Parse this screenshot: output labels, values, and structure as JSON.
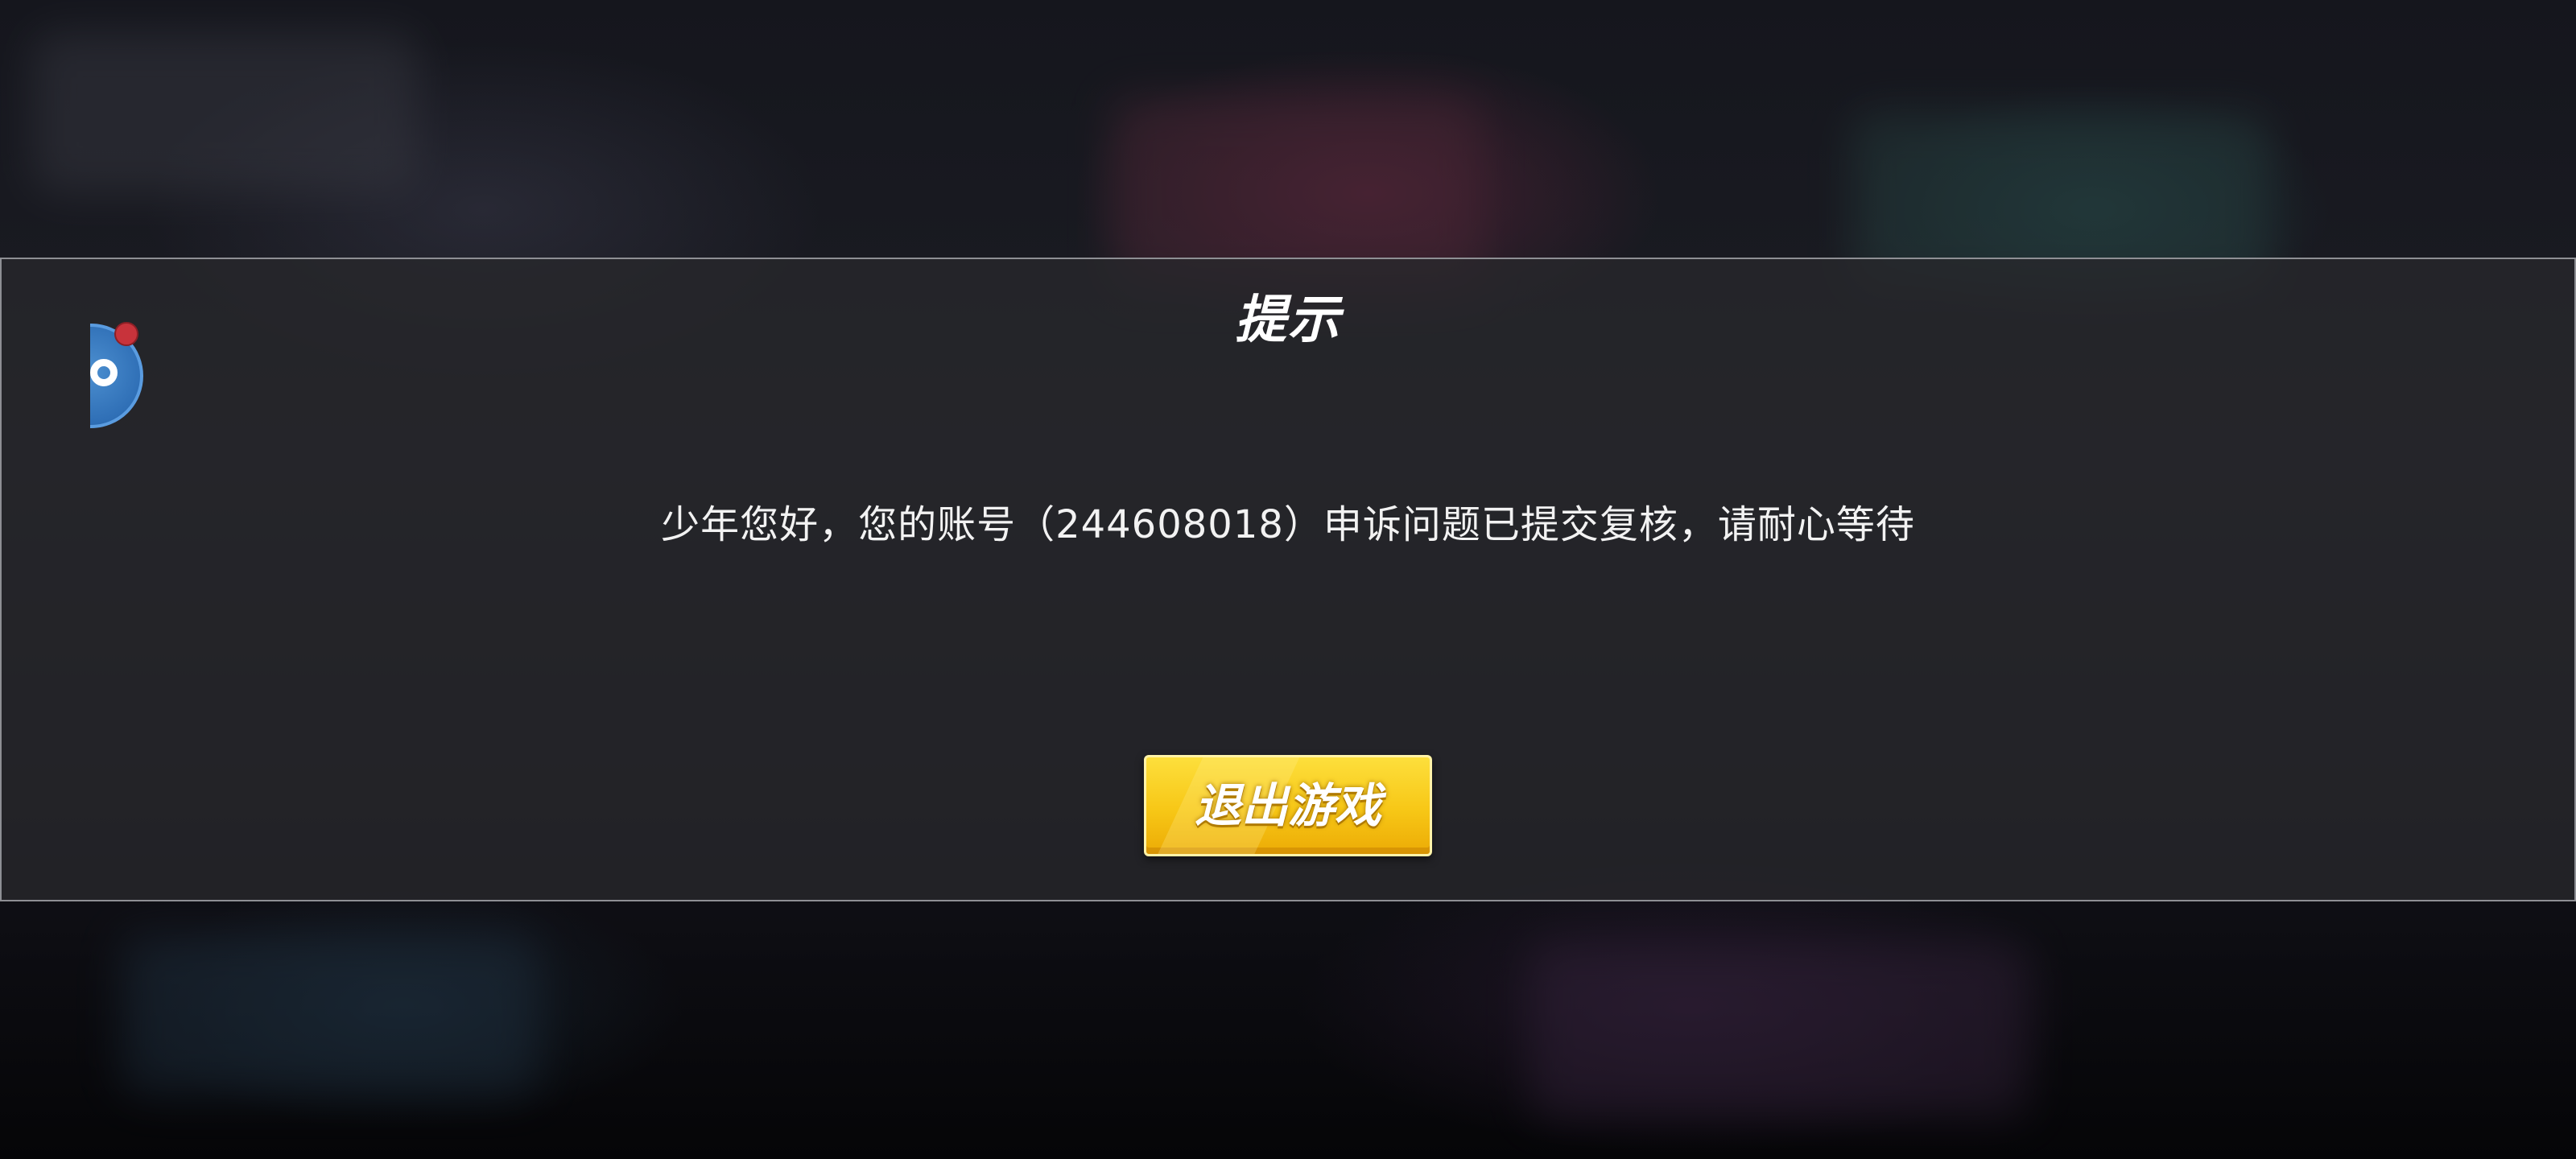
{
  "dialog": {
    "title": "提示",
    "message": "少年您好，您的账号（244608018）申诉问题已提交复核，请耐心等待",
    "exit_button_label": "退出游戏"
  },
  "floating_assistant": {
    "icon": "float-assistant-icon",
    "has_notification": true
  },
  "colors": {
    "button_yellow": "#f7c716",
    "dialog_border": "#8e8f94",
    "badge_red": "#c8333b",
    "assistant_blue": "#2f6fb6"
  }
}
